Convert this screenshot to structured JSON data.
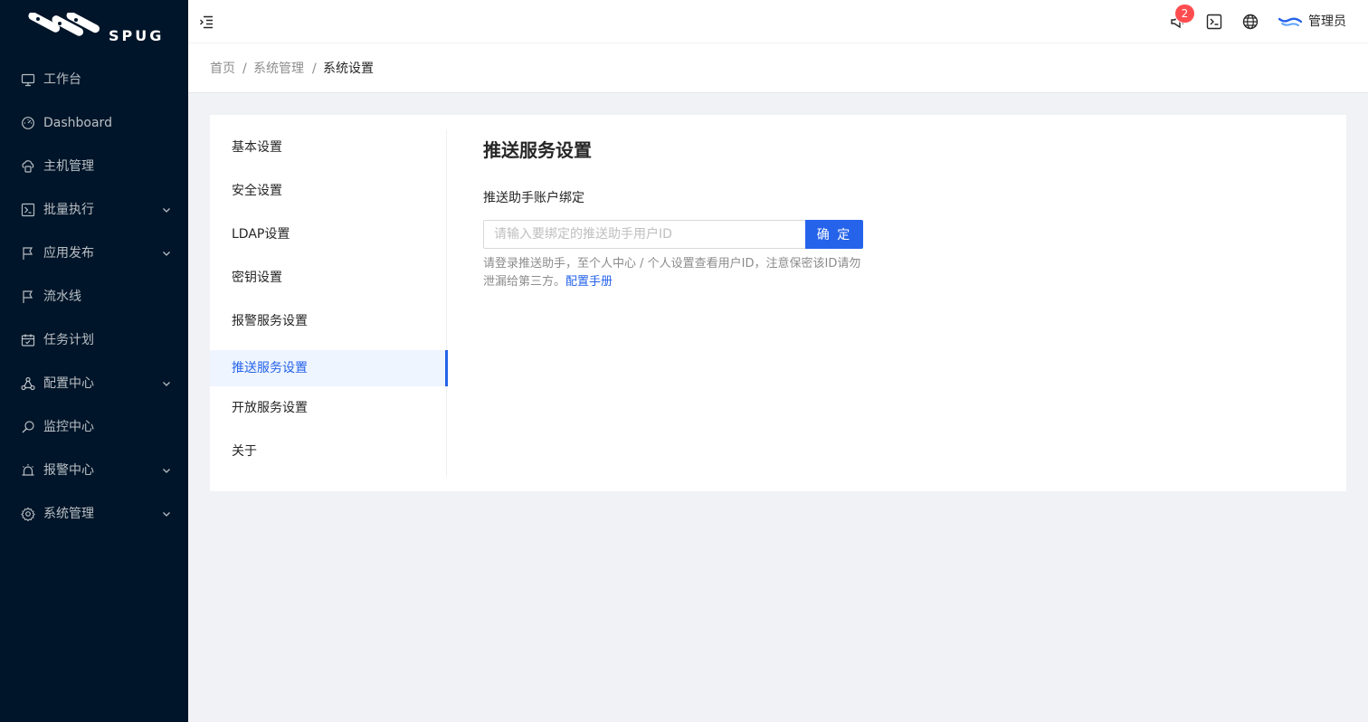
{
  "brand": {
    "name": "SPUG"
  },
  "sidebar": {
    "items": [
      {
        "label": "工作台",
        "icon": "desktop-icon",
        "expandable": false
      },
      {
        "label": "Dashboard",
        "icon": "dashboard-icon",
        "expandable": false
      },
      {
        "label": "主机管理",
        "icon": "cloud-server-icon",
        "expandable": false
      },
      {
        "label": "批量执行",
        "icon": "terminal-icon",
        "expandable": true
      },
      {
        "label": "应用发布",
        "icon": "flag-icon",
        "expandable": true
      },
      {
        "label": "流水线",
        "icon": "flag-icon",
        "expandable": false
      },
      {
        "label": "任务计划",
        "icon": "schedule-icon",
        "expandable": false
      },
      {
        "label": "配置中心",
        "icon": "cluster-icon",
        "expandable": true
      },
      {
        "label": "监控中心",
        "icon": "monitor-icon",
        "expandable": false
      },
      {
        "label": "报警中心",
        "icon": "alert-icon",
        "expandable": true
      },
      {
        "label": "系统管理",
        "icon": "setting-icon",
        "expandable": true
      }
    ]
  },
  "header": {
    "notification_count": "2",
    "user_name": "管理员",
    "icons": [
      "menu-fold-icon",
      "notification-icon",
      "terminal-icon",
      "globe-icon",
      "avatar-icon"
    ]
  },
  "breadcrumb": [
    "首页",
    "系统管理",
    "系统设置"
  ],
  "settings_menu": {
    "items": [
      "基本设置",
      "安全设置",
      "LDAP设置",
      "密钥设置",
      "报警服务设置",
      "推送服务设置",
      "开放服务设置",
      "关于"
    ],
    "active": "推送服务设置"
  },
  "content": {
    "title": "推送服务设置",
    "field_label": "推送助手账户绑定",
    "input_value": "",
    "input_placeholder": "请输入要绑定的推送助手用户ID",
    "confirm_label": "确 定",
    "help_text": "请登录推送助手，至个人中心 / 个人设置查看用户ID，注意保密该ID请勿泄漏给第三方。",
    "help_link": "配置手册"
  },
  "colors": {
    "sidebar_bg": "#001529",
    "primary": "#2563eb",
    "badge": "#ff4d4f"
  }
}
